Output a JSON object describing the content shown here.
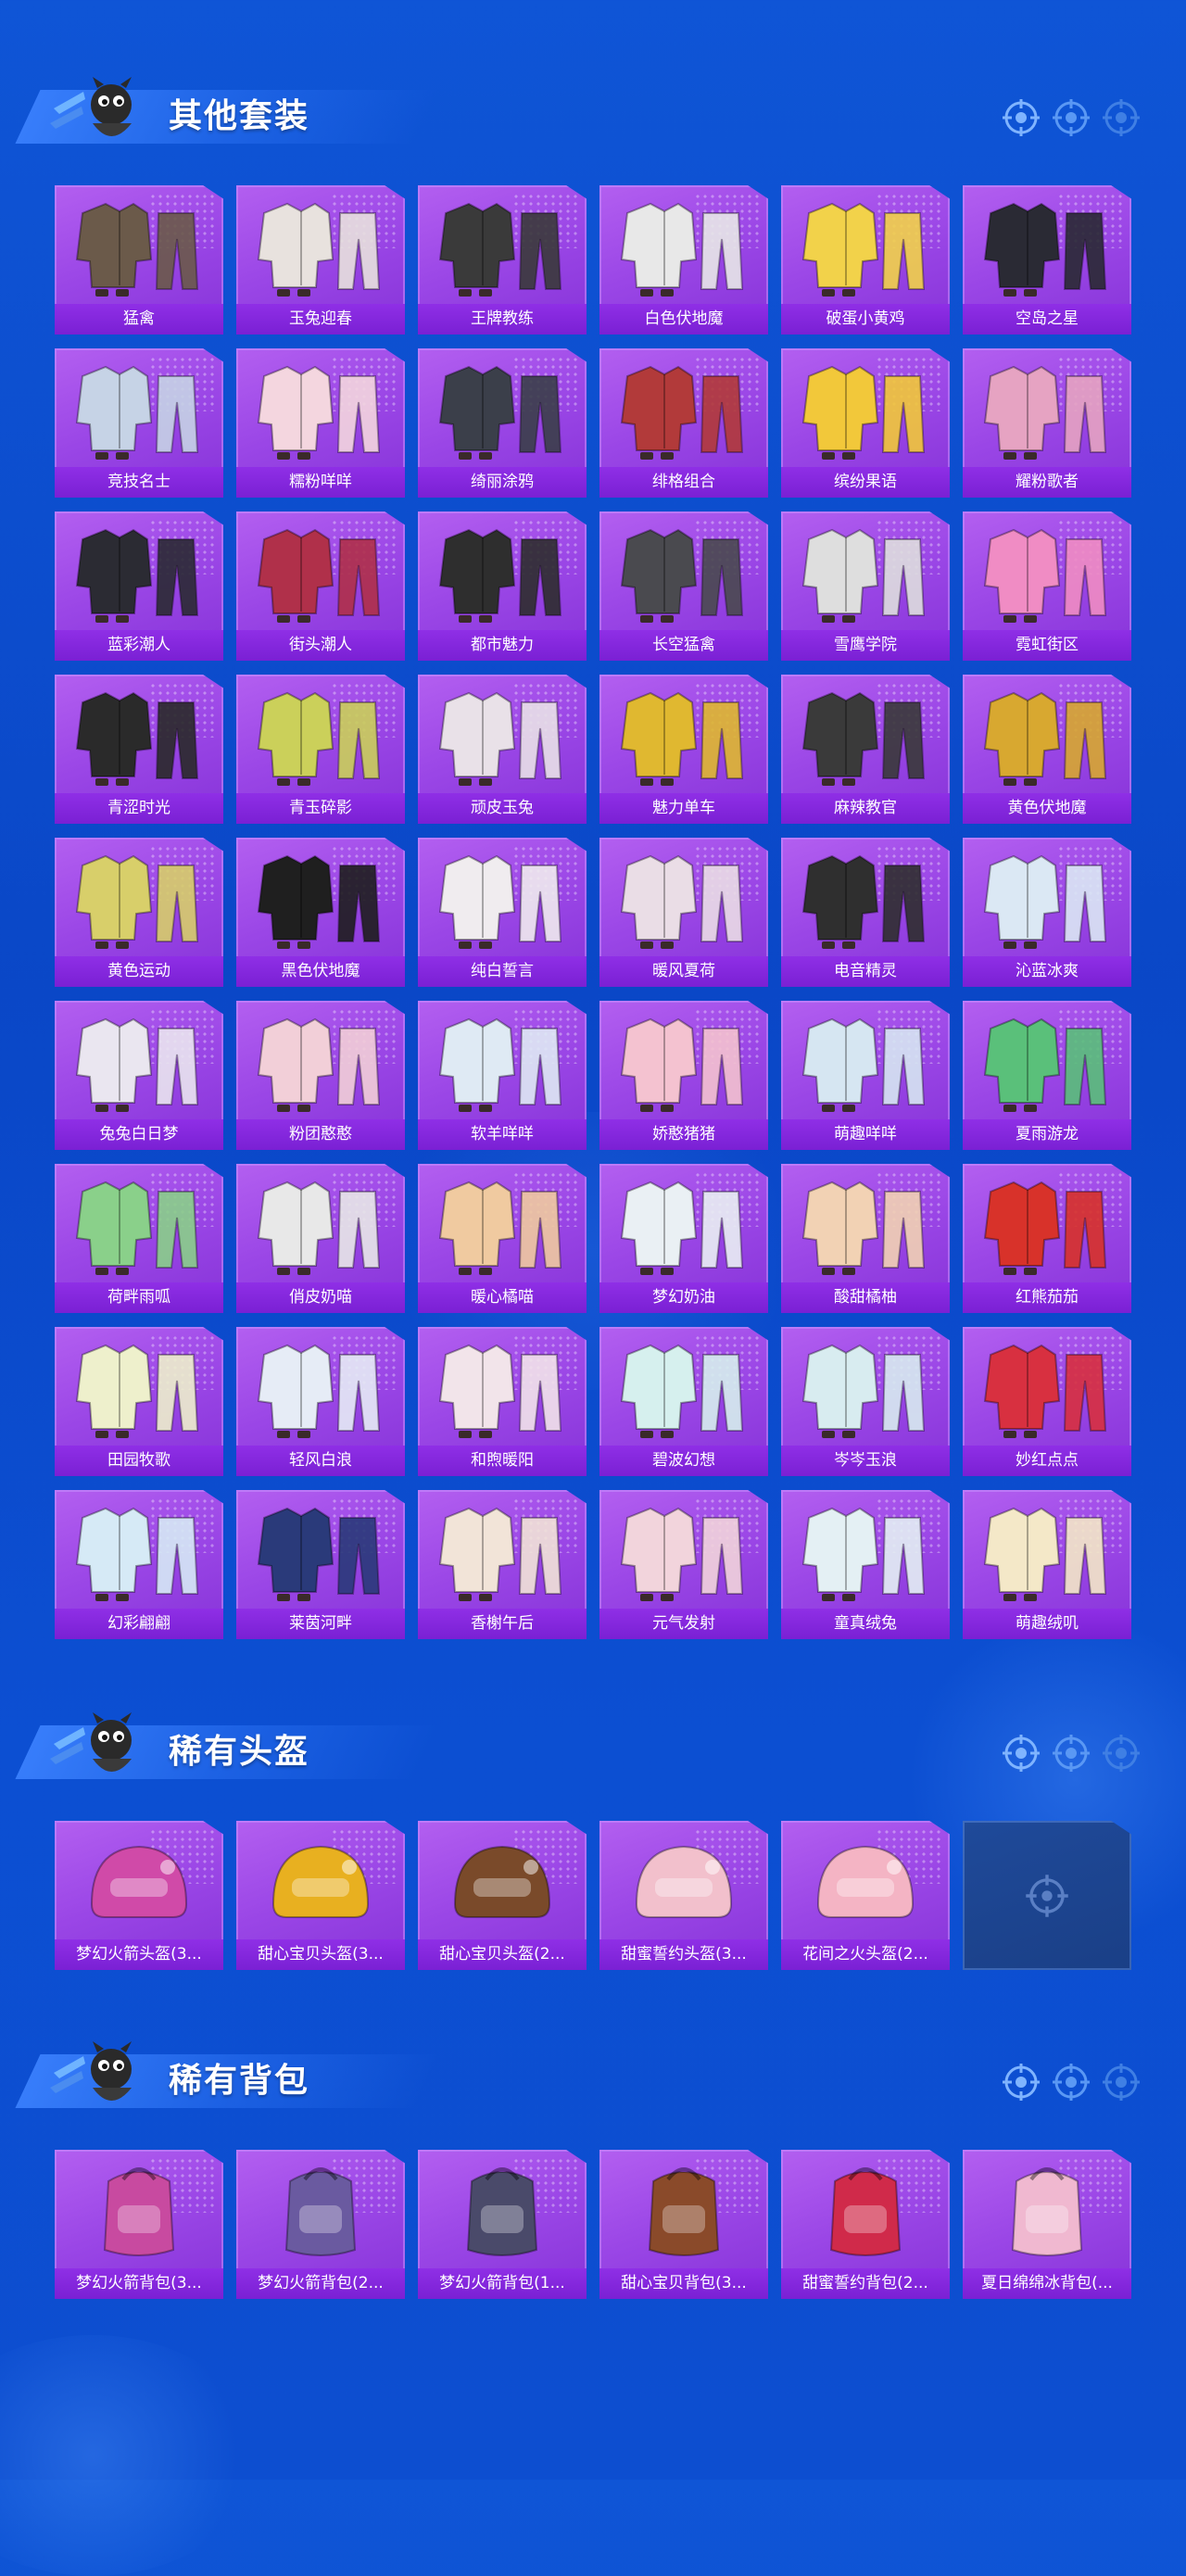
{
  "colors": {
    "background": "#0c4cd0",
    "card": "#9a46e6",
    "label_bar": "#8a2ae0",
    "title": "#ffffff"
  },
  "sections": [
    {
      "title": "其他套装",
      "items": [
        {
          "label": "猛禽",
          "icon": "outfit-icon",
          "tone": "#6b5a4a"
        },
        {
          "label": "玉兔迎春",
          "icon": "outfit-icon",
          "tone": "#e8e2de"
        },
        {
          "label": "王牌教练",
          "icon": "outfit-icon",
          "tone": "#3a3a3a"
        },
        {
          "label": "白色伏地魔",
          "icon": "outfit-icon",
          "tone": "#e8e8e8"
        },
        {
          "label": "破蛋小黄鸡",
          "icon": "outfit-icon",
          "tone": "#f2d24a"
        },
        {
          "label": "空岛之星",
          "icon": "outfit-icon",
          "tone": "#2a2a34"
        },
        {
          "label": "竞技名士",
          "icon": "outfit-icon",
          "tone": "#c6d3e6"
        },
        {
          "label": "糯粉咩咩",
          "icon": "outfit-icon",
          "tone": "#f4d6df"
        },
        {
          "label": "绮丽涂鸦",
          "icon": "outfit-icon",
          "tone": "#3b3f4a"
        },
        {
          "label": "绯格组合",
          "icon": "outfit-icon",
          "tone": "#b23a3a"
        },
        {
          "label": "缤纷果语",
          "icon": "outfit-icon",
          "tone": "#f2c83a"
        },
        {
          "label": "耀粉歌者",
          "icon": "outfit-icon",
          "tone": "#e6a3c2"
        },
        {
          "label": "蓝彩潮人",
          "icon": "outfit-icon",
          "tone": "#2b2b33"
        },
        {
          "label": "街头潮人",
          "icon": "outfit-icon",
          "tone": "#b0304a"
        },
        {
          "label": "都市魅力",
          "icon": "outfit-icon",
          "tone": "#2e2e2e"
        },
        {
          "label": "长空猛禽",
          "icon": "outfit-icon",
          "tone": "#4a4a4f"
        },
        {
          "label": "雪鹰学院",
          "icon": "outfit-icon",
          "tone": "#dedede"
        },
        {
          "label": "霓虹街区",
          "icon": "outfit-icon",
          "tone": "#f08cc4"
        },
        {
          "label": "青涩时光",
          "icon": "outfit-icon",
          "tone": "#2a2a2a"
        },
        {
          "label": "青玉碎影",
          "icon": "outfit-icon",
          "tone": "#cbd05a"
        },
        {
          "label": "顽皮玉兔",
          "icon": "outfit-icon",
          "tone": "#e9e1e8"
        },
        {
          "label": "魅力单车",
          "icon": "outfit-icon",
          "tone": "#e0b830"
        },
        {
          "label": "麻辣教官",
          "icon": "outfit-icon",
          "tone": "#3a3a3a"
        },
        {
          "label": "黄色伏地魔",
          "icon": "outfit-icon",
          "tone": "#d8a830"
        },
        {
          "label": "黄色运动",
          "icon": "outfit-icon",
          "tone": "#d8cf6a"
        },
        {
          "label": "黑色伏地魔",
          "icon": "outfit-icon",
          "tone": "#1f1f1f"
        },
        {
          "label": "纯白誓言",
          "icon": "outfit-icon",
          "tone": "#f0ecef"
        },
        {
          "label": "暖风夏荷",
          "icon": "outfit-icon",
          "tone": "#eadde6"
        },
        {
          "label": "电音精灵",
          "icon": "outfit-icon",
          "tone": "#2f2f2f"
        },
        {
          "label": "沁蓝冰爽",
          "icon": "outfit-icon",
          "tone": "#dbe8f4"
        },
        {
          "label": "兔兔白日梦",
          "icon": "outfit-icon",
          "tone": "#eae6f0"
        },
        {
          "label": "粉团憨憨",
          "icon": "outfit-icon",
          "tone": "#f2cfd8"
        },
        {
          "label": "软羊咩咩",
          "icon": "outfit-icon",
          "tone": "#dfeaf4"
        },
        {
          "label": "娇憨猪猪",
          "icon": "outfit-icon",
          "tone": "#f4c2d0"
        },
        {
          "label": "萌趣咩咩",
          "icon": "outfit-icon",
          "tone": "#d6e6f2"
        },
        {
          "label": "夏雨游龙",
          "icon": "outfit-icon",
          "tone": "#5ac07a"
        },
        {
          "label": "荷畔雨呱",
          "icon": "outfit-icon",
          "tone": "#8ad08a"
        },
        {
          "label": "俏皮奶喵",
          "icon": "outfit-icon",
          "tone": "#e8e8e8"
        },
        {
          "label": "暖心橘喵",
          "icon": "outfit-icon",
          "tone": "#f0caa0"
        },
        {
          "label": "梦幻奶油",
          "icon": "outfit-icon",
          "tone": "#eaf0f4"
        },
        {
          "label": "酸甜橘柚",
          "icon": "outfit-icon",
          "tone": "#f2d2b4"
        },
        {
          "label": "红熊茄茄",
          "icon": "outfit-icon",
          "tone": "#d8322a"
        },
        {
          "label": "田园牧歌",
          "icon": "outfit-icon",
          "tone": "#eef0cc"
        },
        {
          "label": "轻风白浪",
          "icon": "outfit-icon",
          "tone": "#e6ecf6"
        },
        {
          "label": "和煦暖阳",
          "icon": "outfit-icon",
          "tone": "#f2e4ea"
        },
        {
          "label": "碧波幻想",
          "icon": "outfit-icon",
          "tone": "#d6f0ee"
        },
        {
          "label": "岑岑玉浪",
          "icon": "outfit-icon",
          "tone": "#d8ecf0"
        },
        {
          "label": "妙红点点",
          "icon": "outfit-icon",
          "tone": "#d83040"
        },
        {
          "label": "幻彩翩翩",
          "icon": "outfit-icon",
          "tone": "#d6eaf6"
        },
        {
          "label": "莱茵河畔",
          "icon": "outfit-icon",
          "tone": "#2a3a7a"
        },
        {
          "label": "香榭午后",
          "icon": "outfit-icon",
          "tone": "#f2e4d8"
        },
        {
          "label": "元气发射",
          "icon": "outfit-icon",
          "tone": "#f2d4dc"
        },
        {
          "label": "童真绒兔",
          "icon": "outfit-icon",
          "tone": "#e4f0f4"
        },
        {
          "label": "萌趣绒叽",
          "icon": "outfit-icon",
          "tone": "#f4e8c8"
        }
      ]
    },
    {
      "title": "稀有头盔",
      "items": [
        {
          "label": "梦幻火箭头盔(3...",
          "icon": "helmet-icon",
          "tone": "#d04aa8"
        },
        {
          "label": "甜心宝贝头盔(3...",
          "icon": "helmet-icon",
          "tone": "#e8b020"
        },
        {
          "label": "甜心宝贝头盔(2...",
          "icon": "helmet-icon",
          "tone": "#7a4a2a"
        },
        {
          "label": "甜蜜誓约头盔(3...",
          "icon": "helmet-icon",
          "tone": "#f2c0cc"
        },
        {
          "label": "花间之火头盔(2...",
          "icon": "helmet-icon",
          "tone": "#f4b4c4"
        },
        {
          "label": "",
          "icon": "empty-slot-icon",
          "tone": "#1f4a9a"
        }
      ]
    },
    {
      "title": "稀有背包",
      "items": [
        {
          "label": "梦幻火箭背包(3...",
          "icon": "backpack-icon",
          "tone": "#c84aa0"
        },
        {
          "label": "梦幻火箭背包(2...",
          "icon": "backpack-icon",
          "tone": "#6a5aa0"
        },
        {
          "label": "梦幻火箭背包(1...",
          "icon": "backpack-icon",
          "tone": "#4a4a6a"
        },
        {
          "label": "甜心宝贝背包(3...",
          "icon": "backpack-icon",
          "tone": "#8a4a2a"
        },
        {
          "label": "甜蜜誓约背包(2...",
          "icon": "backpack-icon",
          "tone": "#d02a4a"
        },
        {
          "label": "夏日绵绵冰背包(...",
          "icon": "backpack-icon",
          "tone": "#f0b8d0"
        }
      ]
    }
  ]
}
